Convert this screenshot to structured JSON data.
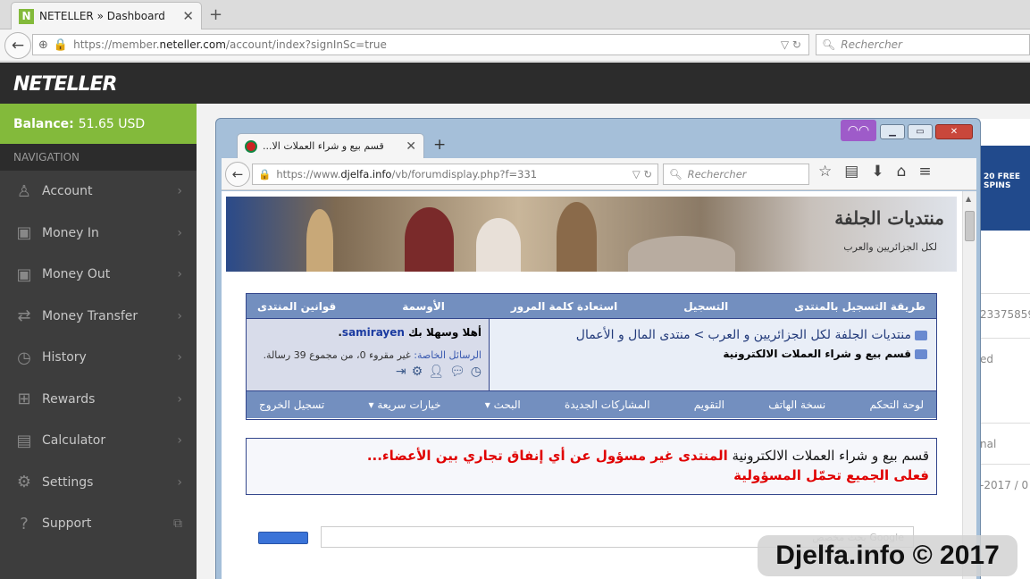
{
  "browser": {
    "tab_title": "NETELLER » Dashboard",
    "tab_favicon": "N",
    "url_pre": "https://member.",
    "url_host": "neteller.com",
    "url_post": "/account/index?signInSc=true",
    "search_placeholder": "Rechercher"
  },
  "app": {
    "logo": "NETELLER",
    "balance_label": "Balance:",
    "balance_value": "51.65 USD",
    "nav_header": "NAVIGATION",
    "nav_items": [
      {
        "label": "Account",
        "icon": "person-icon"
      },
      {
        "label": "Money In",
        "icon": "money-in-icon"
      },
      {
        "label": "Money Out",
        "icon": "money-out-icon"
      },
      {
        "label": "Money Transfer",
        "icon": "transfer-icon"
      },
      {
        "label": "History",
        "icon": "clock-icon"
      },
      {
        "label": "Rewards",
        "icon": "gift-icon"
      },
      {
        "label": "Calculator",
        "icon": "calculator-icon"
      },
      {
        "label": "Settings",
        "icon": "gear-icon"
      },
      {
        "label": "Support",
        "icon": "question-icon"
      }
    ],
    "colors": {
      "accent": "#83ba3b",
      "sidebar": "#3d3d3d",
      "header": "#2c2c2c"
    }
  },
  "right_panel": {
    "ad_text": "20 FREE SPINS",
    "rows": [
      "23375859",
      "ed",
      "nal",
      "-2017 / 0"
    ]
  },
  "inner_browser": {
    "tab_title": "قسم بيع و شراء العملات الا...",
    "url_pre": "https://www.",
    "url_host": "djelfa.info",
    "url_post": "/vb/forumdisplay.php?f=331",
    "search_placeholder": "Rechercher"
  },
  "forum": {
    "banner_title": "منتديات الجلفة",
    "banner_sub": "لكل الجزائريين والعرب",
    "top_links": [
      "طريقة التسجيل بالمنتدى",
      "التسجيل",
      "استعادة كلمة المرور",
      "الأوسمة",
      "قوانين المنتدى"
    ],
    "breadcrumb": {
      "root": "منتديات الجلفة لكل الجزائريين و العرب",
      "sep": ">",
      "section": "منتدى المال و الأعمال",
      "current": "قسم بيع و شراء العملات الالكترونية"
    },
    "welcome": {
      "greeting": "أهلا وسهلا بك",
      "username": "samirayen",
      "pm_label": "الرسائل الخاصة:",
      "pm_text": "غير مقروء 0، من مجموع 39 رسالة."
    },
    "bottom_links": [
      "لوحة التحكم",
      "نسخة الهاتف",
      "التقويم",
      "المشاركات الجديدة",
      "البحث ▾",
      "خيارات سريعة ▾",
      "تسجيل الخروج"
    ],
    "notice_line1": "قسم بيع و شراء العملات الالكترونية",
    "notice_line1_red": "المنتدى غير مسؤول عن أي إنفاق تجاري بين الأعضاء...",
    "notice_line2": "فعلى الجميع تحمّل المسؤولية",
    "google_placeholder": "Google بحث مخصص"
  },
  "watermark": "Djelfa.info © 2017"
}
